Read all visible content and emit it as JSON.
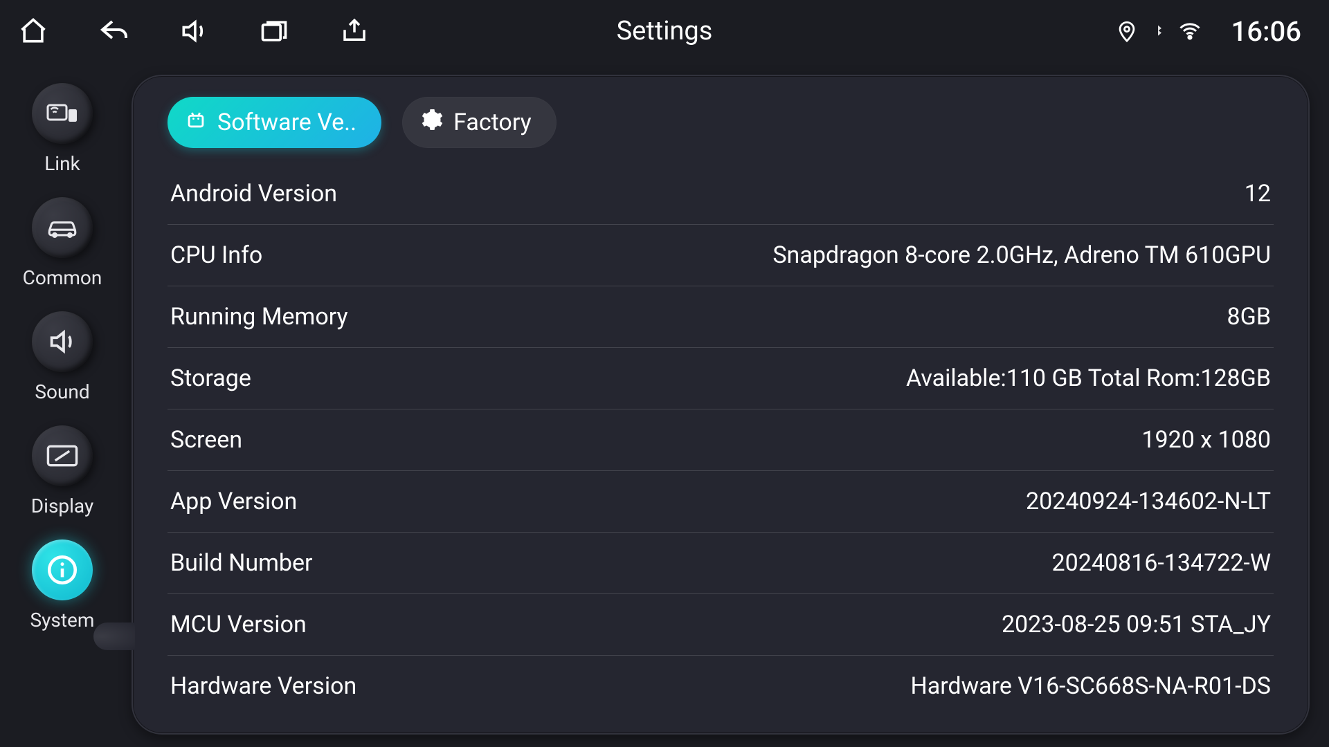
{
  "statusbar": {
    "title": "Settings",
    "time": "16:06"
  },
  "sidebar": {
    "items": [
      {
        "id": "link",
        "label": "Link"
      },
      {
        "id": "common",
        "label": "Common"
      },
      {
        "id": "sound",
        "label": "Sound"
      },
      {
        "id": "display",
        "label": "Display"
      },
      {
        "id": "system",
        "label": "System"
      }
    ],
    "active": "system"
  },
  "tabs": {
    "software": {
      "label": "Software Ve.."
    },
    "factory": {
      "label": "Factory"
    },
    "active": "software"
  },
  "info": [
    {
      "label": "Android Version",
      "value": "12"
    },
    {
      "label": "CPU Info",
      "value": "Snapdragon 8-core 2.0GHz, Adreno TM 610GPU"
    },
    {
      "label": "Running Memory",
      "value": "8GB"
    },
    {
      "label": "Storage",
      "value": "Available:110 GB Total Rom:128GB"
    },
    {
      "label": "Screen",
      "value": "1920 x 1080"
    },
    {
      "label": "App Version",
      "value": "20240924-134602-N-LT"
    },
    {
      "label": "Build Number",
      "value": "20240816-134722-W"
    },
    {
      "label": "MCU Version",
      "value": "2023-08-25 09:51 STA_JY"
    },
    {
      "label": "Hardware Version",
      "value": "Hardware V16-SC668S-NA-R01-DS"
    }
  ]
}
